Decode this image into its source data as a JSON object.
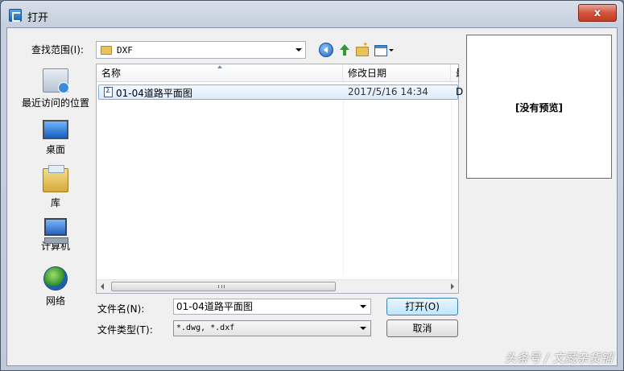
{
  "window": {
    "title": "打开",
    "close_label": "x"
  },
  "lookin": {
    "label": "查找范围(I):",
    "value": "DXF"
  },
  "places": [
    {
      "label": "最近访问的位置",
      "icon": "recent-places-icon"
    },
    {
      "label": "桌面",
      "icon": "desktop-icon"
    },
    {
      "label": "库",
      "icon": "library-icon"
    },
    {
      "label": "计算机",
      "icon": "computer-icon"
    },
    {
      "label": "网络",
      "icon": "network-icon"
    }
  ],
  "filelist": {
    "columns": [
      "名称",
      "修改日期",
      "最"
    ],
    "rows": [
      {
        "name": "01-04道路平面图",
        "date": "2017/5/16 14:34",
        "more": "D"
      }
    ],
    "scroll_grip": "III"
  },
  "preview": {
    "text": "[没有预览]"
  },
  "filename": {
    "label": "文件名(N):",
    "value": "01-04道路平面图"
  },
  "filetype": {
    "label": "文件类型(T):",
    "value": "*.dwg, *.dxf"
  },
  "buttons": {
    "open": "打开(O)",
    "cancel": "取消"
  },
  "watermark": "头条号 / 文藏杂货铺"
}
